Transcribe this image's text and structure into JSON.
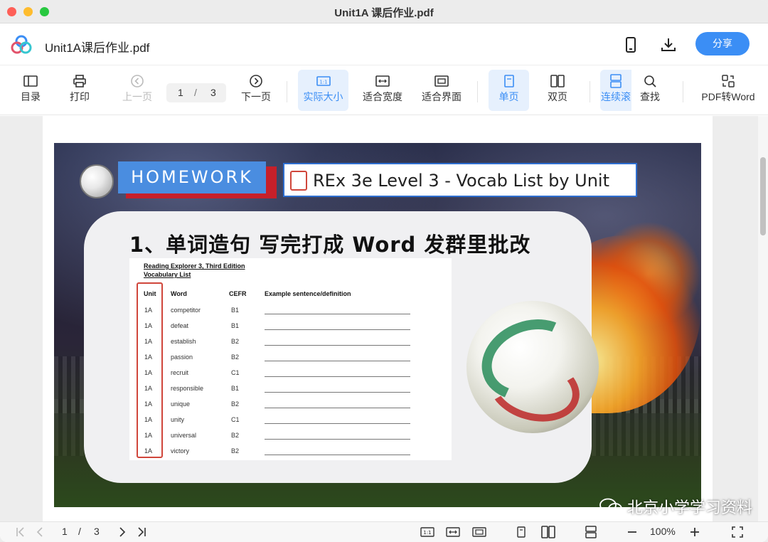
{
  "window": {
    "title": "Unit1A 课后作业.pdf"
  },
  "app": {
    "filename": "Unit1A课后作业.pdf",
    "share_label": "分享",
    "accent_color": "#3b8ef5"
  },
  "toolbar": {
    "toc": "目录",
    "print": "打印",
    "prev": "上一页",
    "current_page": "1",
    "slash": "/",
    "total_pages": "3",
    "next": "下一页",
    "actual_size": "实际大小",
    "fit_width": "适合宽度",
    "fit_page": "适合界面",
    "single": "单页",
    "double": "双页",
    "continuous": "连续滚",
    "find": "查找",
    "pdf_to_word": "PDF转Word"
  },
  "slide": {
    "homework": "HOMEWORK",
    "vocab_title": "REx 3e Level 3 - Vocab List by Unit",
    "heading": "1、单词造句 写完打成 Word 发群里批改",
    "sheet_title_line1": "Reading Explorer 3, Third Edition",
    "sheet_title_line2": "Vocabulary List",
    "headers": [
      "Unit",
      "Word",
      "CEFR",
      "Example sentence/definition"
    ],
    "rows": [
      {
        "unit": "1A",
        "word": "competitor",
        "cefr": "B1"
      },
      {
        "unit": "1A",
        "word": "defeat",
        "cefr": "B1"
      },
      {
        "unit": "1A",
        "word": "establish",
        "cefr": "B2"
      },
      {
        "unit": "1A",
        "word": "passion",
        "cefr": "B2"
      },
      {
        "unit": "1A",
        "word": "recruit",
        "cefr": "C1"
      },
      {
        "unit": "1A",
        "word": "responsible",
        "cefr": "B1"
      },
      {
        "unit": "1A",
        "word": "unique",
        "cefr": "B2"
      },
      {
        "unit": "1A",
        "word": "unity",
        "cefr": "C1"
      },
      {
        "unit": "1A",
        "word": "universal",
        "cefr": "B2"
      },
      {
        "unit": "1A",
        "word": "victory",
        "cefr": "B2"
      }
    ]
  },
  "watermark": "北京小学学习资料",
  "statusbar": {
    "current_page": "1",
    "slash": "/",
    "total_pages": "3",
    "zoom": "100%"
  }
}
